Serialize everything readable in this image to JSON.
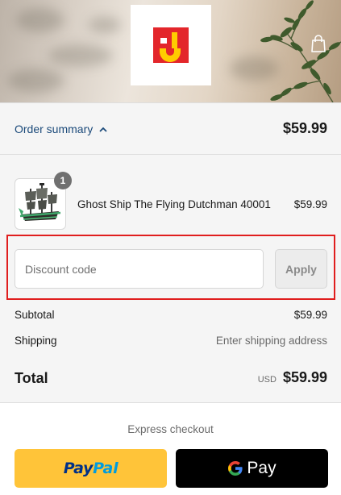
{
  "colors": {
    "link": "#1b4a7a",
    "highlight": "#e01e1e",
    "paypal_bg": "#ffc439",
    "gpay_bg": "#000000",
    "logo_red": "#e3262b",
    "logo_yellow": "#ffcc00"
  },
  "header": {
    "logo_icon": "store-logo",
    "cart_icon": "shopping-bag-icon"
  },
  "order_summary": {
    "toggle_label": "Order summary",
    "toggle_icon": "chevron-up-icon",
    "total": "$59.99"
  },
  "line_item": {
    "quantity": "1",
    "name": "Ghost Ship The Flying Dutchman 40001",
    "price": "$59.99"
  },
  "discount": {
    "placeholder": "Discount code",
    "value": "",
    "apply_label": "Apply"
  },
  "totals": {
    "subtotal_label": "Subtotal",
    "subtotal_value": "$59.99",
    "shipping_label": "Shipping",
    "shipping_value": "Enter shipping address",
    "total_label": "Total",
    "currency": "USD",
    "total_value": "$59.99"
  },
  "express": {
    "label": "Express checkout",
    "paypal_part1": "Pay",
    "paypal_part2": "Pal",
    "gpay_label": "Pay"
  }
}
